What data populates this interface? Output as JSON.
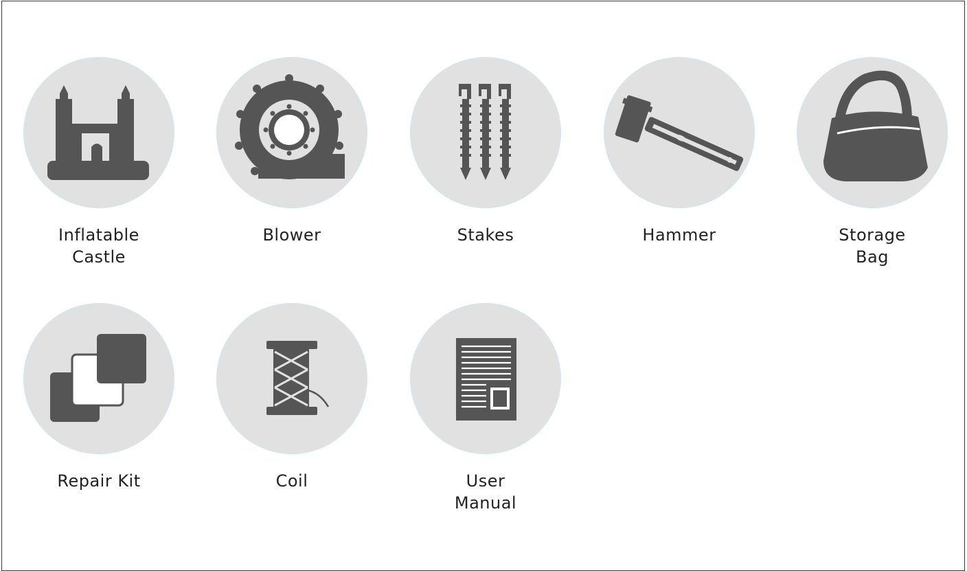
{
  "items": [
    {
      "label": "Inflatable\nCastle",
      "icon": "inflatable-castle-icon"
    },
    {
      "label": "Blower",
      "icon": "blower-icon"
    },
    {
      "label": "Stakes",
      "icon": "stakes-icon"
    },
    {
      "label": "Hammer",
      "icon": "hammer-icon"
    },
    {
      "label": "Storage\nBag",
      "icon": "storage-bag-icon"
    },
    {
      "label": "Repair Kit",
      "icon": "repair-kit-icon"
    },
    {
      "label": "Coil",
      "icon": "coil-icon"
    },
    {
      "label": "User\nManual",
      "icon": "user-manual-icon"
    }
  ],
  "colors": {
    "circle": "#e1e1e1",
    "icon": "#555555",
    "text": "#222222",
    "outline": "#cfe6f2"
  }
}
